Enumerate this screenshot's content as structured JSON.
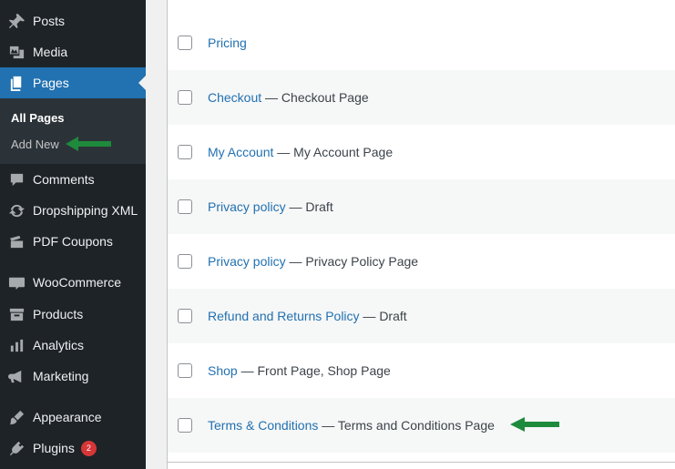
{
  "sidebar": {
    "items": [
      {
        "label": "Posts",
        "icon": "pin-icon"
      },
      {
        "label": "Media",
        "icon": "media-icon"
      },
      {
        "label": "Pages",
        "icon": "pages-icon"
      },
      {
        "label": "Comments",
        "icon": "comment-icon"
      },
      {
        "label": "Dropshipping XML",
        "icon": "sync-icon"
      },
      {
        "label": "PDF Coupons",
        "icon": "coupon-icon"
      },
      {
        "label": "WooCommerce",
        "icon": "woo-icon"
      },
      {
        "label": "Products",
        "icon": "archive-icon"
      },
      {
        "label": "Analytics",
        "icon": "chart-icon"
      },
      {
        "label": "Marketing",
        "icon": "megaphone-icon"
      },
      {
        "label": "Appearance",
        "icon": "brush-icon"
      },
      {
        "label": "Plugins",
        "icon": "plug-icon",
        "badge": "2"
      }
    ],
    "submenu": {
      "all_pages": "All Pages",
      "add_new": "Add New"
    },
    "colors": {
      "background": "#1d2327",
      "active": "#2271b1",
      "submenu": "#2c3338"
    }
  },
  "pages": {
    "rows": [
      {
        "title": "Pricing",
        "state": ""
      },
      {
        "title": "Checkout",
        "state": " — Checkout Page"
      },
      {
        "title": "My Account",
        "state": " — My Account Page"
      },
      {
        "title": "Privacy policy",
        "state": " — Draft"
      },
      {
        "title": "Privacy policy",
        "state": " — Privacy Policy Page"
      },
      {
        "title": "Refund and Returns Policy",
        "state": " — Draft"
      },
      {
        "title": "Shop",
        "state": " — Front Page, Shop Page"
      },
      {
        "title": "Terms & Conditions",
        "state": " — Terms and Conditions Page"
      }
    ],
    "colors": {
      "link": "#2271b1",
      "arrow": "#1e8a3c"
    }
  }
}
